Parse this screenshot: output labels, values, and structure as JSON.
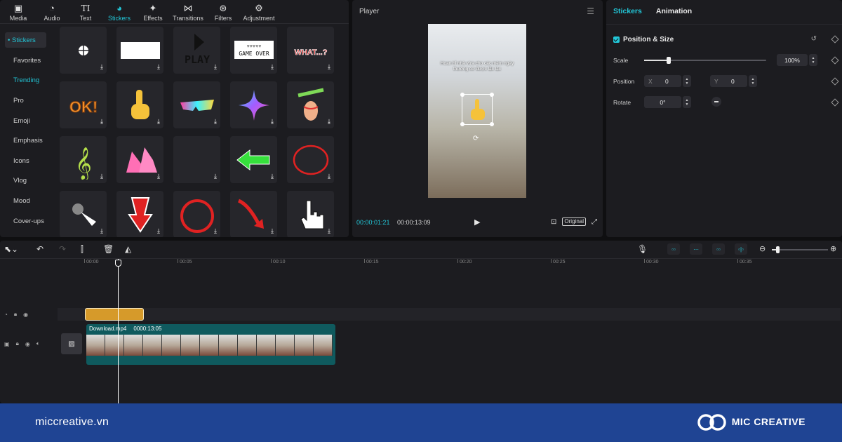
{
  "top_tabs": [
    {
      "label": "Media",
      "icon": "media-icon"
    },
    {
      "label": "Audio",
      "icon": "audio-icon"
    },
    {
      "label": "Text",
      "icon": "text-icon"
    },
    {
      "label": "Stickers",
      "icon": "stickers-icon"
    },
    {
      "label": "Effects",
      "icon": "effects-icon"
    },
    {
      "label": "Transitions",
      "icon": "transitions-icon"
    },
    {
      "label": "Filters",
      "icon": "filters-icon"
    },
    {
      "label": "Adjustment",
      "icon": "adjustment-icon"
    }
  ],
  "categories": {
    "header": "• Stickers",
    "items": [
      "Favorites",
      "Trending",
      "Pro",
      "Emoji",
      "Emphasis",
      "Icons",
      "Vlog",
      "Mood",
      "Cover-ups"
    ],
    "active": "Trending"
  },
  "stickers": [
    {
      "name": "globe-sticker"
    },
    {
      "name": "white-rectangle-sticker"
    },
    {
      "name": "play-text-sticker",
      "text": "PLAY"
    },
    {
      "name": "game-over-sticker",
      "text": "GAME OVER"
    },
    {
      "name": "what-sticker",
      "text": "WHAT...?"
    },
    {
      "name": "ok-sticker",
      "text": "OK!"
    },
    {
      "name": "pointing-hand-sticker"
    },
    {
      "name": "rainbow-glasses-sticker"
    },
    {
      "name": "sparkle-star-sticker"
    },
    {
      "name": "hand-pen-sticker"
    },
    {
      "name": "music-note-sticker"
    },
    {
      "name": "pink-heels-sticker"
    },
    {
      "name": "empty-sticker"
    },
    {
      "name": "green-arrow-sticker"
    },
    {
      "name": "red-circle-sticker"
    },
    {
      "name": "cursor-click-sticker"
    },
    {
      "name": "red-down-arrow-sticker"
    },
    {
      "name": "red-ring-sticker"
    },
    {
      "name": "red-curved-arrow-sticker"
    },
    {
      "name": "pointer-hand-sticker"
    }
  ],
  "player": {
    "title": "Player",
    "caption": "Hoan hỉ nhà vừa cho các mèm ngày thường cơ được lặc lạc",
    "current_time": "00:00:01:21",
    "total_time": "00:00:13:09",
    "original_label": "Original"
  },
  "properties": {
    "tabs": [
      "Stickers",
      "Animation"
    ],
    "section": "Position & Size",
    "scale_label": "Scale",
    "scale_value": "100%",
    "scale_fraction": 0.2,
    "position_label": "Position",
    "x_label": "X",
    "x_value": "0",
    "y_label": "Y",
    "y_value": "0",
    "rotate_label": "Rotate",
    "rotate_value": "0°"
  },
  "timeline": {
    "ruler": [
      "00:00",
      "00:05",
      "00:10",
      "00:15",
      "00:20",
      "00:25",
      "00:30",
      "00:35"
    ],
    "clip_name": "Download.mp4",
    "clip_duration": "0000:13:05",
    "zoom_fraction": 0.1
  },
  "footer": {
    "site": "miccreative.vn",
    "brand": "MIC CREATIVE"
  },
  "colors": {
    "accent": "#22c7d8",
    "footer_bg": "#1f4493",
    "sticker_clip": "#d69a2a",
    "video_clip": "#0f5a5e"
  }
}
